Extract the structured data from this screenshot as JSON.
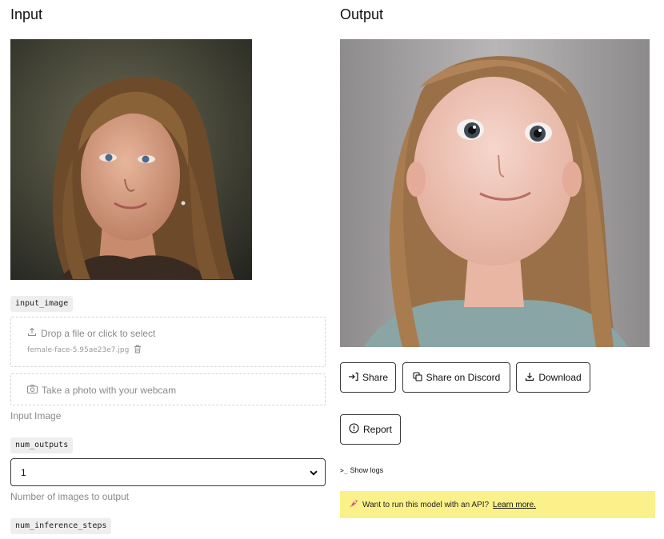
{
  "input": {
    "title": "Input",
    "image_param": "input_image",
    "dropzone": {
      "label": "Drop a file or click to select",
      "filename": "female-face-5.95ae23e7.jpg"
    },
    "webcam_label": "Take a photo with your webcam",
    "image_help": "Input Image",
    "num_outputs": {
      "param": "num_outputs",
      "value": "1",
      "help": "Number of images to output"
    },
    "next_param": "num_inference_steps"
  },
  "output": {
    "title": "Output",
    "buttons": {
      "share": "Share",
      "discord": "Share on Discord",
      "download": "Download",
      "report": "Report"
    },
    "show_logs": "Show logs",
    "banner": {
      "text": "Want to run this model with an API?",
      "link": "Learn more."
    }
  },
  "colors": {
    "banner_bg": "#fbf18a",
    "border": "#3a3a3a",
    "tag_bg": "#eeeeee"
  }
}
